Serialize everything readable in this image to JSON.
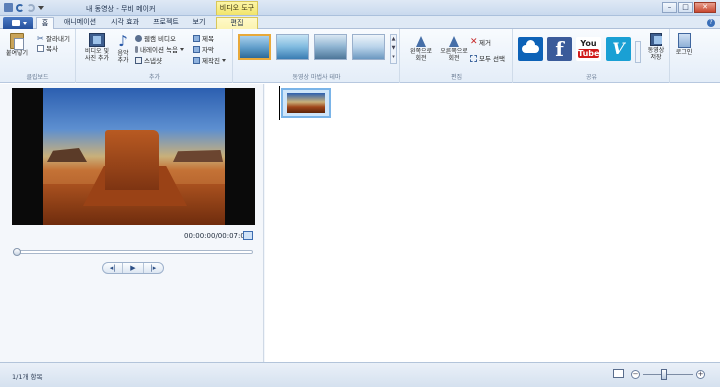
{
  "window": {
    "title": "내 동영상 - 무비 메이커",
    "context_header": "비디오 도구",
    "buttons": {
      "minimize": "–",
      "maximize": "□",
      "close": "✕"
    }
  },
  "tabs": [
    {
      "label": "홈",
      "active": true
    },
    {
      "label": "애니메이션"
    },
    {
      "label": "시각 효과"
    },
    {
      "label": "프로젝트"
    },
    {
      "label": "보기"
    },
    {
      "label": "편집",
      "contextual": true
    }
  ],
  "help_label": "?",
  "ribbon": {
    "clipboard": {
      "label": "클립보드",
      "paste": "붙여넣기",
      "cut": "잘라내기",
      "copy": "복사"
    },
    "add": {
      "label": "추가",
      "add_videos_line1": "비디오 및",
      "add_videos_line2": "사진 추가",
      "add_music_line1": "음악",
      "add_music_line2": "추가",
      "webcam_video": "웹캠 비디오",
      "record_narration": "내레이션 녹음",
      "snapshot": "스냅샷",
      "title": "제목",
      "caption": "자막",
      "credits": "제작진"
    },
    "themes": {
      "label": "동영상 마법사 테마",
      "scroll_up": "▲",
      "scroll_down": "▼",
      "more": "▾"
    },
    "editing": {
      "label": "편집",
      "rotate_left_line1": "왼쪽으로",
      "rotate_left_line2": "회전",
      "rotate_right_line1": "오른쪽으로",
      "rotate_right_line2": "회전",
      "remove": "제거",
      "select_all": "모두 선택"
    },
    "share": {
      "label": "공유",
      "facebook": "f",
      "youtube_you": "You",
      "youtube_tube": "Tube",
      "vimeo": "V",
      "save_movie_line1": "동영상",
      "save_movie_line2": "저장"
    },
    "signin": {
      "label": "로그인"
    }
  },
  "preview": {
    "timecode": "00:00:00/00:07:00",
    "transport": {
      "prev": "◂|",
      "play": "▶",
      "next": "|▸"
    },
    "seek_position": 0.0
  },
  "status": {
    "items_count": "1/1개 항목",
    "zoom_out": "−",
    "zoom_in": "+"
  },
  "colors": {
    "accent": "#24509c",
    "context_tab": "#f1e46b",
    "selected_theme": "#e8a93a"
  }
}
